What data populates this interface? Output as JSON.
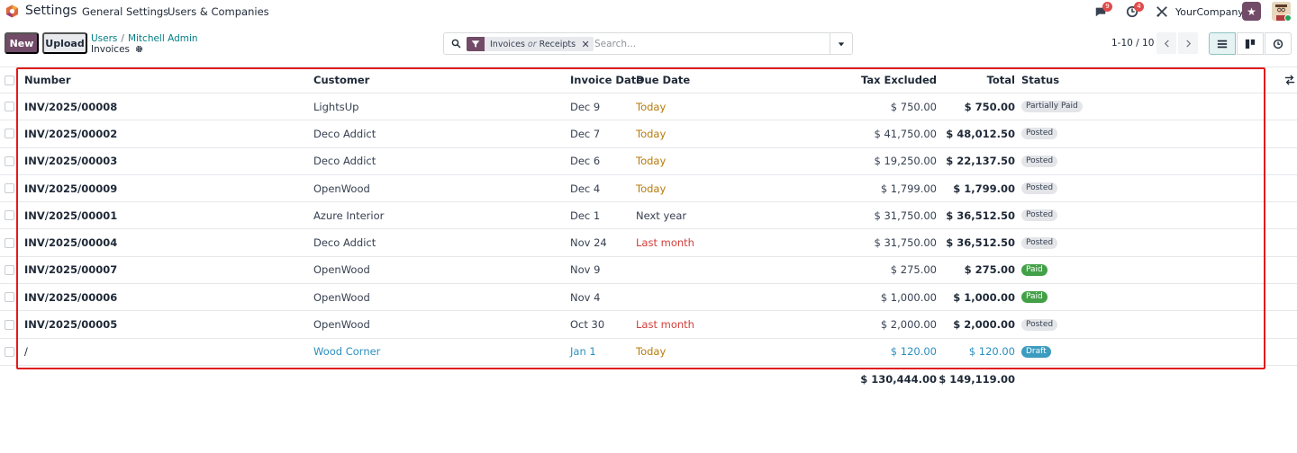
{
  "navbar": {
    "app_title": "Settings",
    "menu": [
      "General Settings",
      "Users & Companies"
    ],
    "chat_badge": "9",
    "activity_badge": "4",
    "company": "YourCompany"
  },
  "control_panel": {
    "new_label": "New",
    "upload_label": "Upload",
    "breadcrumb": [
      "Users",
      "Mitchell Admin"
    ],
    "page_title": "Invoices",
    "facet_left": "Invoices",
    "facet_or": "or",
    "facet_right": "Receipts",
    "search_placeholder": "Search...",
    "pager": "1-10 / 10"
  },
  "columns": {
    "number": "Number",
    "customer": "Customer",
    "invoice_date": "Invoice Date",
    "due_date": "Due Date",
    "tax_excluded": "Tax Excluded",
    "total": "Total",
    "status": "Status"
  },
  "rows": [
    {
      "number": "INV/2025/00008",
      "customer": "LightsUp",
      "invoice_date": "Dec 9",
      "due_date": "Today",
      "due_style": "warning",
      "tax_excluded": "$ 750.00",
      "total": "$ 750.00",
      "status": "Partially Paid",
      "status_style": "grey"
    },
    {
      "number": "INV/2025/00002",
      "customer": "Deco Addict",
      "invoice_date": "Dec 7",
      "due_date": "Today",
      "due_style": "warning",
      "tax_excluded": "$ 41,750.00",
      "total": "$ 48,012.50",
      "status": "Posted",
      "status_style": "grey"
    },
    {
      "number": "INV/2025/00003",
      "customer": "Deco Addict",
      "invoice_date": "Dec 6",
      "due_date": "Today",
      "due_style": "warning",
      "tax_excluded": "$ 19,250.00",
      "total": "$ 22,137.50",
      "status": "Posted",
      "status_style": "grey"
    },
    {
      "number": "INV/2025/00009",
      "customer": "OpenWood",
      "invoice_date": "Dec 4",
      "due_date": "Today",
      "due_style": "warning",
      "tax_excluded": "$ 1,799.00",
      "total": "$ 1,799.00",
      "status": "Posted",
      "status_style": "grey"
    },
    {
      "number": "INV/2025/00001",
      "customer": "Azure Interior",
      "invoice_date": "Dec 1",
      "due_date": "Next year",
      "due_style": "normal",
      "tax_excluded": "$ 31,750.00",
      "total": "$ 36,512.50",
      "status": "Posted",
      "status_style": "grey"
    },
    {
      "number": "INV/2025/00004",
      "customer": "Deco Addict",
      "invoice_date": "Nov 24",
      "due_date": "Last month",
      "due_style": "danger",
      "tax_excluded": "$ 31,750.00",
      "total": "$ 36,512.50",
      "status": "Posted",
      "status_style": "grey"
    },
    {
      "number": "INV/2025/00007",
      "customer": "OpenWood",
      "invoice_date": "Nov 9",
      "due_date": "",
      "due_style": "normal",
      "tax_excluded": "$ 275.00",
      "total": "$ 275.00",
      "status": "Paid",
      "status_style": "green"
    },
    {
      "number": "INV/2025/00006",
      "customer": "OpenWood",
      "invoice_date": "Nov 4",
      "due_date": "",
      "due_style": "normal",
      "tax_excluded": "$ 1,000.00",
      "total": "$ 1,000.00",
      "status": "Paid",
      "status_style": "green"
    },
    {
      "number": "INV/2025/00005",
      "customer": "OpenWood",
      "invoice_date": "Oct 30",
      "due_date": "Last month",
      "due_style": "danger",
      "tax_excluded": "$ 2,000.00",
      "total": "$ 2,000.00",
      "status": "Posted",
      "status_style": "grey"
    },
    {
      "number": "/",
      "customer": "Wood Corner",
      "invoice_date": "Jan 1",
      "due_date": "Today",
      "due_style": "warning",
      "tax_excluded": "$ 120.00",
      "total": "$ 120.00",
      "status": "Draft",
      "status_style": "blue",
      "draft": true
    }
  ],
  "totals": {
    "tax_excluded": "$ 130,444.00",
    "total": "$ 149,119.00"
  },
  "icons": {
    "chat": "chat-icon",
    "activity": "clock-icon",
    "tools": "tools-icon",
    "star": "star-icon",
    "search": "search-icon",
    "filter": "filter-icon",
    "list_view": "list-view-icon",
    "kanban_view": "kanban-view-icon",
    "activity_view": "activity-view-icon",
    "optional_columns": "column-toggle-icon"
  },
  "colors": {
    "brand": "#714b67",
    "link": "#017e84",
    "warning": "#b77b0b",
    "danger": "#d23f3a",
    "highlight": "#e01c1c"
  }
}
